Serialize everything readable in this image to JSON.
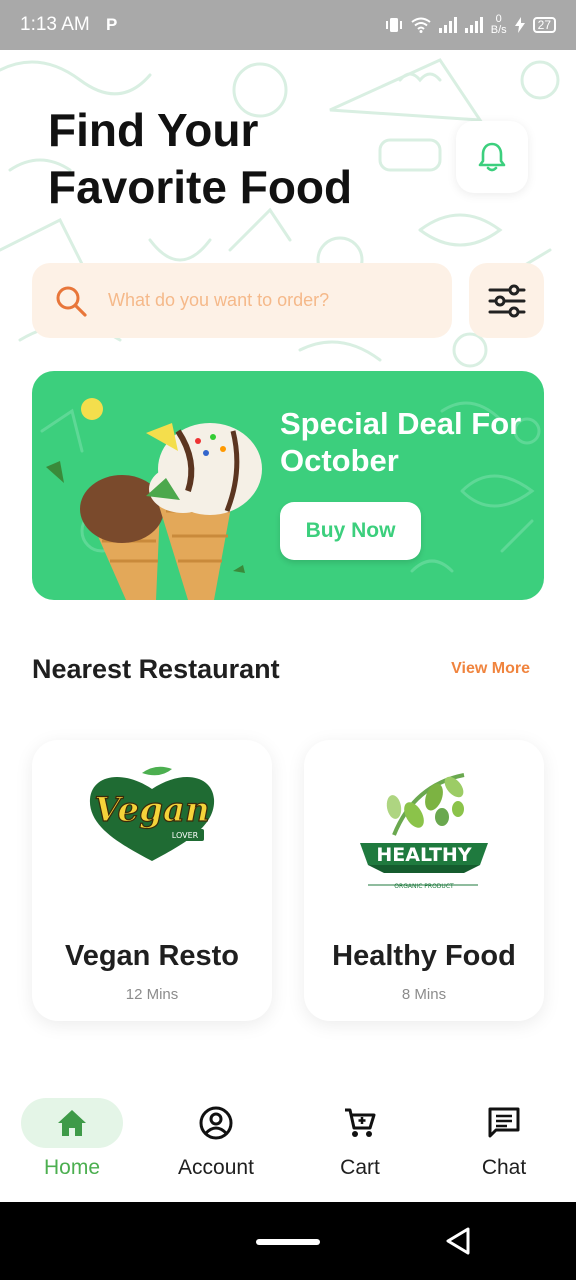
{
  "status_bar": {
    "time": "1:13 AM",
    "netspeed_top": "0",
    "netspeed_bottom": "B/s",
    "battery": "27",
    "icons": [
      "parking-icon",
      "vibrate-icon",
      "wifi-icon",
      "signal-icon",
      "charging-icon"
    ]
  },
  "header": {
    "title_line1": "Find Your",
    "title_line2": "Favorite Food",
    "notification_icon": "bell-icon"
  },
  "search": {
    "placeholder": "What do you want to order?",
    "icon": "search-icon",
    "filter_icon": "filter-sliders-icon"
  },
  "promo": {
    "title": "Special Deal For October",
    "button_label": "Buy Now"
  },
  "nearest": {
    "section_title": "Nearest Restaurant",
    "view_more": "View More",
    "restaurants": [
      {
        "name": "Vegan Resto",
        "time": "12 Mins",
        "logo_text_main": "Vegan",
        "logo_text_sub": "LOVER"
      },
      {
        "name": "Healthy Food",
        "time": "8 Mins",
        "logo_text_main": "HEALTHY",
        "logo_text_sub": "ORGANIC PRODUCT"
      }
    ]
  },
  "bottom_nav": {
    "items": [
      {
        "label": "Home",
        "icon": "home-icon",
        "active": true
      },
      {
        "label": "Account",
        "icon": "account-icon",
        "active": false
      },
      {
        "label": "Cart",
        "icon": "cart-icon",
        "active": false
      },
      {
        "label": "Chat",
        "icon": "chat-icon",
        "active": false
      }
    ]
  },
  "colors": {
    "accent_green": "#3ccf7d",
    "nav_active": "#4caf50",
    "orange": "#f0843e",
    "search_bg": "#fdf1e6"
  }
}
